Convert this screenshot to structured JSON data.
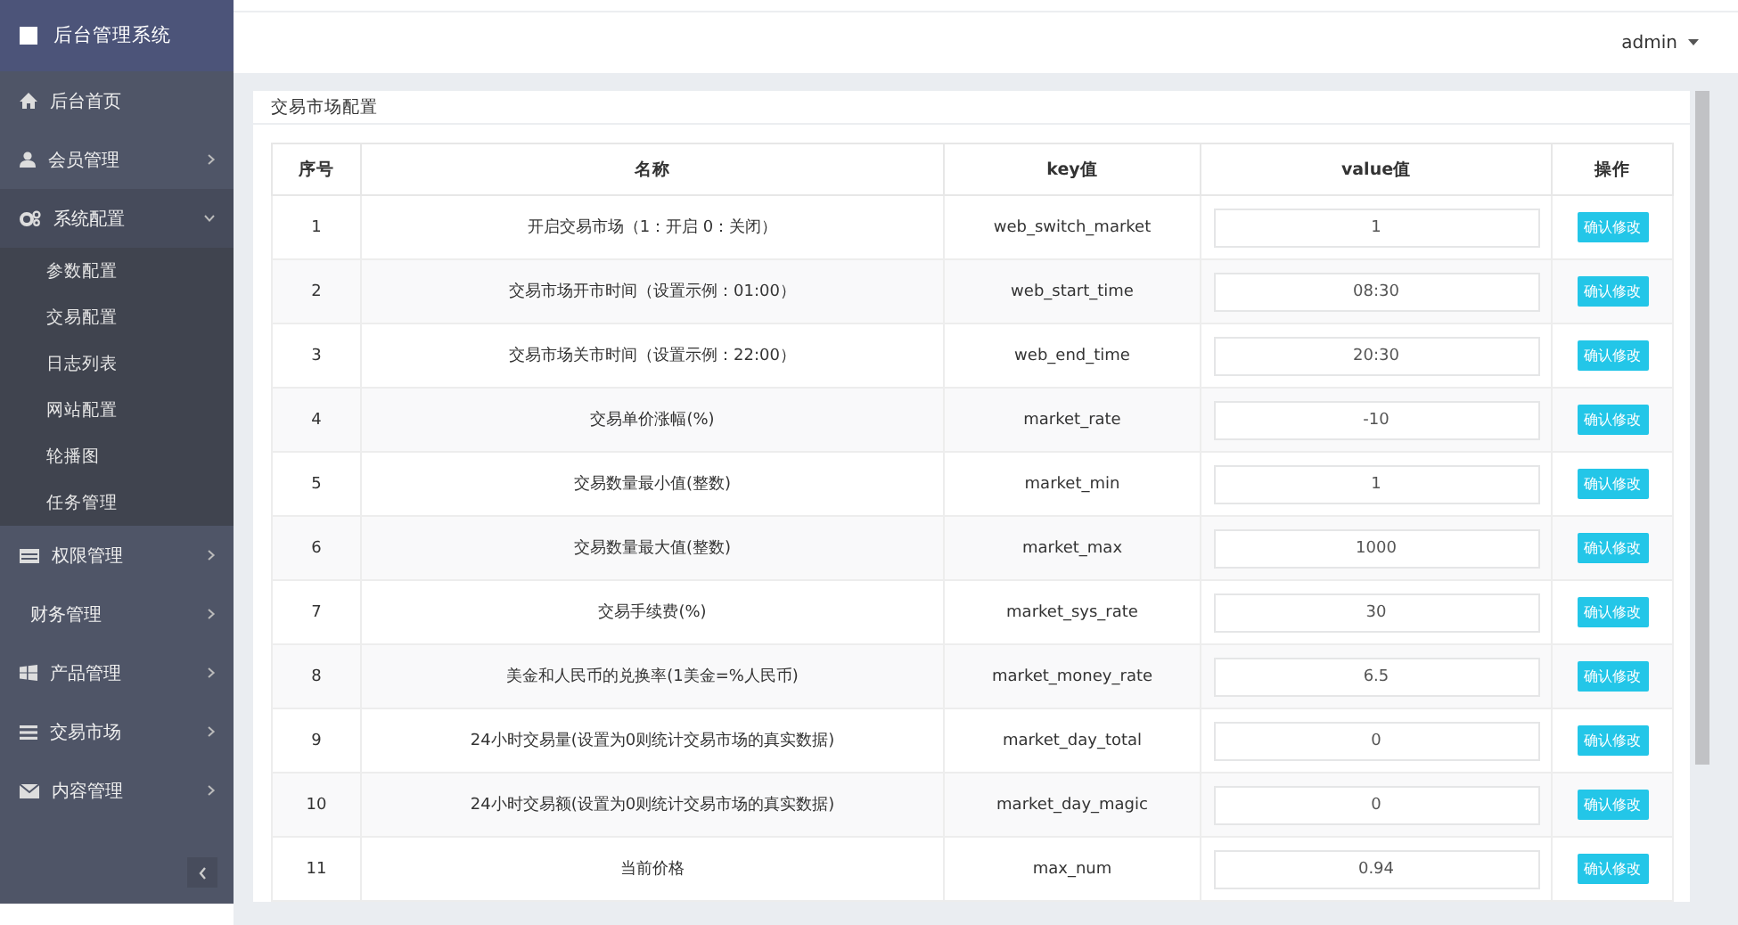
{
  "sidebar": {
    "title": "后台管理系统",
    "items": [
      {
        "label": "后台首页",
        "expanded": false,
        "has_children": false
      },
      {
        "label": "会员管理",
        "expanded": false,
        "has_children": true
      },
      {
        "label": "系统配置",
        "expanded": true,
        "has_children": true,
        "children": [
          {
            "label": "参数配置"
          },
          {
            "label": "交易配置"
          },
          {
            "label": "日志列表"
          },
          {
            "label": "网站配置"
          },
          {
            "label": "轮播图"
          },
          {
            "label": "任务管理"
          }
        ]
      },
      {
        "label": "权限管理",
        "expanded": false,
        "has_children": true
      },
      {
        "label": "财务管理",
        "expanded": false,
        "has_children": true
      },
      {
        "label": "产品管理",
        "expanded": false,
        "has_children": true
      },
      {
        "label": "交易市场",
        "expanded": false,
        "has_children": true
      },
      {
        "label": "内容管理",
        "expanded": false,
        "has_children": true
      }
    ]
  },
  "header": {
    "user": "admin"
  },
  "panel": {
    "title": "交易市场配置",
    "table": {
      "columns": [
        "序号",
        "名称",
        "key值",
        "value值",
        "操作"
      ],
      "rows": [
        {
          "index": "1",
          "name": "开启交易市场（1：开启 0：关闭）",
          "key": "web_switch_market",
          "value": "1",
          "action": "确认修改"
        },
        {
          "index": "2",
          "name": "交易市场开市时间（设置示例：01:00）",
          "key": "web_start_time",
          "value": "08:30",
          "action": "确认修改"
        },
        {
          "index": "3",
          "name": "交易市场关市时间（设置示例：22:00）",
          "key": "web_end_time",
          "value": "20:30",
          "action": "确认修改"
        },
        {
          "index": "4",
          "name": "交易单价涨幅(%)",
          "key": "market_rate",
          "value": "-10",
          "action": "确认修改"
        },
        {
          "index": "5",
          "name": "交易数量最小值(整数)",
          "key": "market_min",
          "value": "1",
          "action": "确认修改"
        },
        {
          "index": "6",
          "name": "交易数量最大值(整数)",
          "key": "market_max",
          "value": "1000",
          "action": "确认修改"
        },
        {
          "index": "7",
          "name": "交易手续费(%)",
          "key": "market_sys_rate",
          "value": "30",
          "action": "确认修改"
        },
        {
          "index": "8",
          "name": "美金和人民币的兑换率(1美金=%人民币)",
          "key": "market_money_rate",
          "value": "6.5",
          "action": "确认修改"
        },
        {
          "index": "9",
          "name": "24小时交易量(设置为0则统计交易市场的真实数据)",
          "key": "market_day_total",
          "value": "0",
          "action": "确认修改"
        },
        {
          "index": "10",
          "name": "24小时交易额(设置为0则统计交易市场的真实数据)",
          "key": "market_day_magic",
          "value": "0",
          "action": "确认修改"
        },
        {
          "index": "11",
          "name": "当前价格",
          "key": "max_num",
          "value": "0.94",
          "action": "确认修改"
        }
      ]
    }
  }
}
